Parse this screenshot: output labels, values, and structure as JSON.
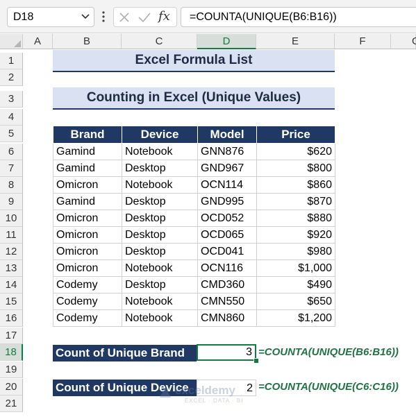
{
  "formula_bar": {
    "name_box": "D18",
    "cancel_icon": "x-icon",
    "enter_icon": "check-icon",
    "function_label": "fx",
    "formula": "=COUNTA(UNIQUE(B6:B16))"
  },
  "columns": [
    "A",
    "B",
    "C",
    "D",
    "E",
    "F",
    "G"
  ],
  "active_column": "D",
  "rows": [
    "1",
    "2",
    "3",
    "4",
    "5",
    "6",
    "7",
    "8",
    "9",
    "10",
    "11",
    "12",
    "13",
    "14",
    "15",
    "16",
    "17",
    "18",
    "19",
    "20",
    "21"
  ],
  "active_row": "18",
  "main_title": "Excel Formula List",
  "sub_title": "Counting in Excel (Unique Values)",
  "table": {
    "headers": [
      "Brand",
      "Device",
      "Model",
      "Price"
    ],
    "rows": [
      [
        "Gamind",
        "Notebook",
        "GNN876",
        "$620"
      ],
      [
        "Gamind",
        "Desktop",
        "GND967",
        "$800"
      ],
      [
        "Omicron",
        "Notebook",
        "OCN114",
        "$860"
      ],
      [
        "Gamind",
        "Desktop",
        "GND995",
        "$870"
      ],
      [
        "Omicron",
        "Desktop",
        "OCD052",
        "$880"
      ],
      [
        "Omicron",
        "Desktop",
        "OCD065",
        "$920"
      ],
      [
        "Omicron",
        "Desktop",
        "OCD041",
        "$980"
      ],
      [
        "Omicron",
        "Notebook",
        "OCN116",
        "$1,000"
      ],
      [
        "Codemy",
        "Desktop",
        "CMD360",
        "$490"
      ],
      [
        "Codemy",
        "Notebook",
        "CMN550",
        "$650"
      ],
      [
        "Codemy",
        "Notebook",
        "CMN860",
        "$1,200"
      ]
    ]
  },
  "counts": [
    {
      "label": "Count of Unique Brand",
      "value": "3",
      "formula": "=COUNTA(UNIQUE(B6:B16))"
    },
    {
      "label": "Count of Unique Device",
      "value": "2",
      "formula": "=COUNTA(UNIQUE(C6:C16))"
    }
  ],
  "watermark": {
    "name": "exceldemy",
    "tagline": "EXCEL · DATA · BI"
  },
  "colors": {
    "header_fill": "#203864",
    "title_fill": "#d9e1f2",
    "excel_green": "#107c41",
    "formula_text": "#217346"
  }
}
